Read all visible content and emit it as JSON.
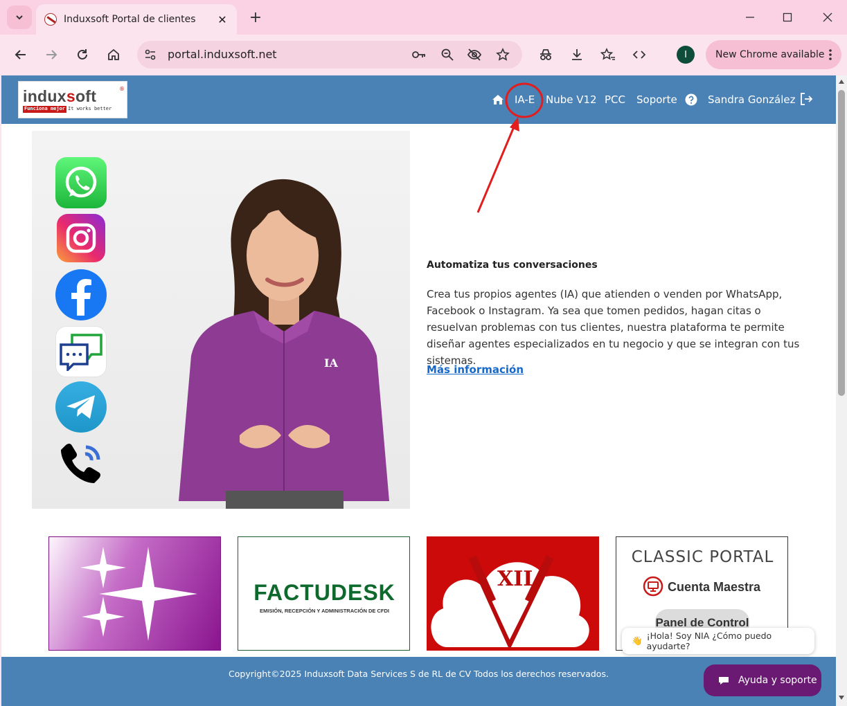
{
  "browser": {
    "tab_title": "Induxsoft Portal de clientes",
    "url": "portal.induxsoft.net",
    "profile_initial": "I",
    "update_label": "New Chrome available"
  },
  "nav": {
    "items": [
      "IA-E",
      "Nube V12",
      "PCC",
      "Soporte"
    ],
    "user_name": "Sandra González"
  },
  "logo": {
    "brand_prefix": "indux",
    "brand_accent": "s",
    "brand_suffix": "oft",
    "reg": "®",
    "tag_a": "Funciona mejor",
    "tag_b": "It works better"
  },
  "hero": {
    "shirt_label": "IA",
    "title": "Automatiza tus conversaciones",
    "body": "Crea tus propios agentes (IA) que atienden o venden por WhatsApp, Facebook o Instagram. Ya sea que tomen pedidos, hagan citas o resuelvan problemas con tus clientes, nuestra plataforma te permite diseñar agentes especializados en tu negocio y que se integran con tus sistemas.",
    "link": "Más información"
  },
  "cards": {
    "factudesk_title": "FACTUDESK",
    "factudesk_sub": "EMISIÓN, RECEPCIÓN Y ADMINISTRACIÓN DE CFDI",
    "nube_label": "XII",
    "classic_title": "CLASSIC PORTAL",
    "classic_account": "Cuenta Maestra",
    "classic_panel": "Panel de Control"
  },
  "footer": {
    "copyright": "Copyright©2025 Induxsoft Data Services S de RL de CV Todos los derechos reservados."
  },
  "chat": {
    "greeting_emoji": "👋",
    "greeting": "¡Hola! Soy NIA ¿Cómo puedo ayudarte?",
    "help_label": "Ayuda y soporte"
  },
  "colors": {
    "nav_bg": "#4a82b6",
    "annotation_red": "#e11d1d",
    "help_purple": "#6b1a73"
  }
}
